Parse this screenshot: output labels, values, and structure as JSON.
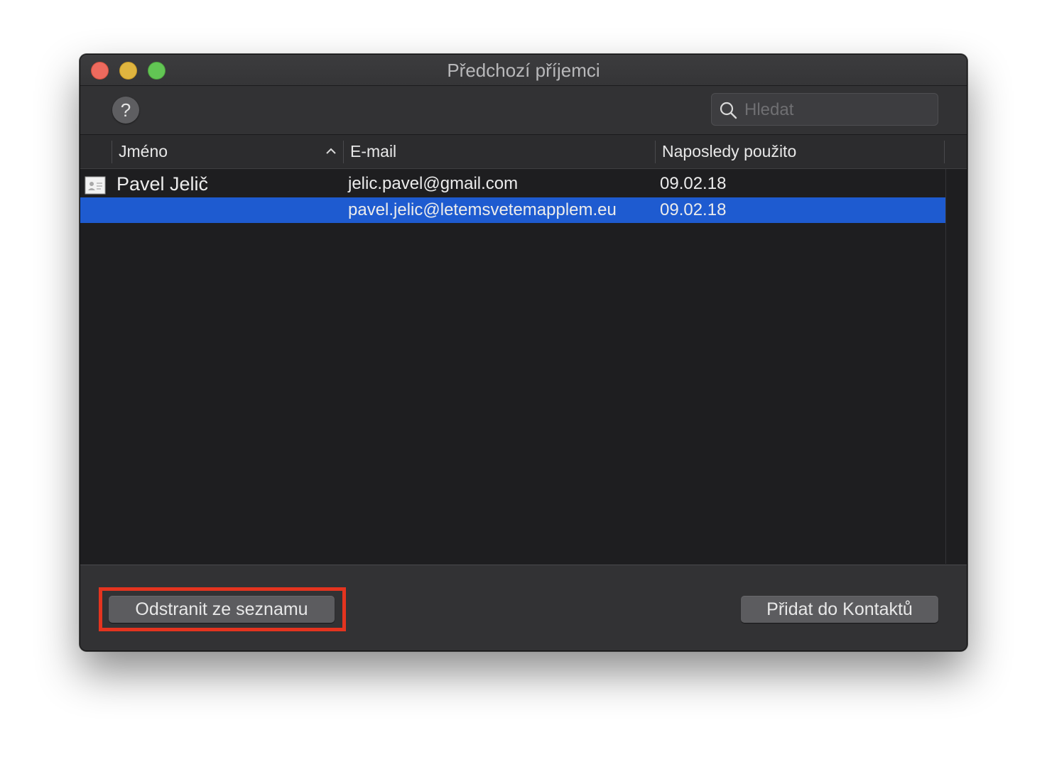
{
  "window": {
    "title": "Předchozí příjemci"
  },
  "toolbar": {
    "help_label": "?",
    "search_placeholder": "Hledat",
    "search_value": ""
  },
  "table": {
    "columns": [
      {
        "label": "Jméno",
        "sorted": "ascending"
      },
      {
        "label": "E-mail"
      },
      {
        "label": "Naposledy použito"
      }
    ],
    "rows": [
      {
        "name": "Pavel Jelič",
        "email": "jelic.pavel@gmail.com",
        "last_used": "09.02.18",
        "selected": false,
        "icon": "contact-card-icon"
      },
      {
        "name": "",
        "email": "pavel.jelic@letemsvetemapplem.eu",
        "last_used": "09.02.18",
        "selected": true
      }
    ]
  },
  "footer": {
    "remove_label": "Odstranit ze seznamu",
    "add_label": "Přidat do Kontaktů"
  },
  "colors": {
    "selection": "#1e5bd0",
    "annotation": "#e4341f",
    "close": "#ed6a5e",
    "minimize": "#e0b53f",
    "maximize": "#62c554"
  }
}
